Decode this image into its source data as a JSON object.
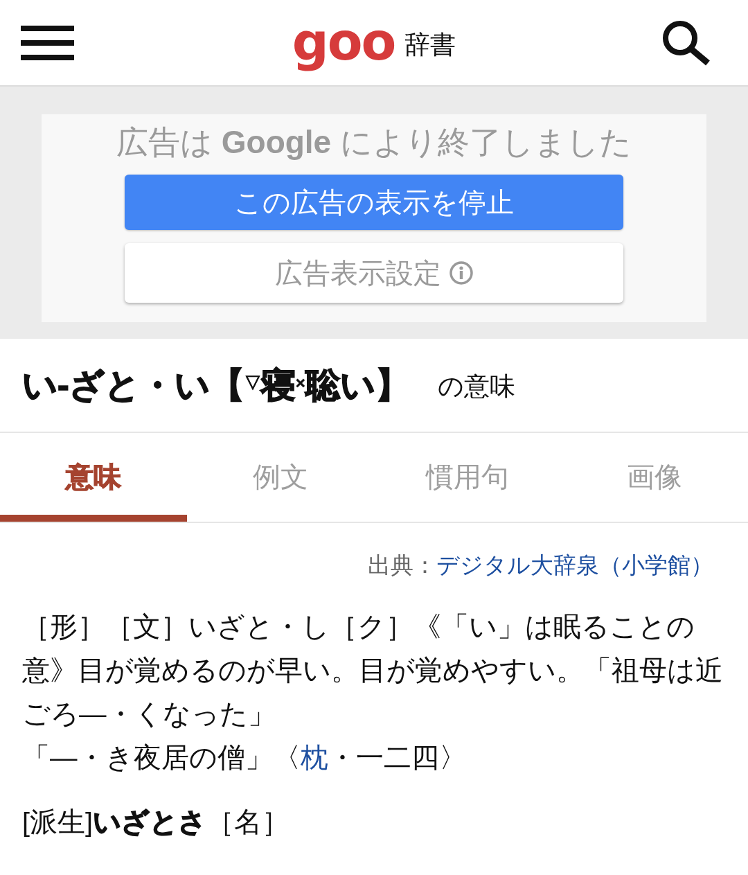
{
  "header": {
    "logo": "goo",
    "logo_label": "辞書"
  },
  "ad_notice": {
    "message": "広告は **Google** により終了しました",
    "buttons": [
      {
        "label": "この広告の表示を停止",
        "kind": "primary"
      },
      {
        "label": "広告表示設定",
        "kind": "secondary"
      }
    ]
  },
  "entry": {
    "headword": "い‐ざと・い【$^{▽}$寝$^{×}$聡い】",
    "suffix": "の意味"
  },
  "tabs": [
    {
      "label": "意味",
      "selected": true
    },
    {
      "label": "例文",
      "selected": false
    },
    {
      "label": "慣用句",
      "selected": false
    },
    {
      "label": "画像",
      "selected": false
    }
  ],
  "source": {
    "label": "出典：",
    "link": "デジタル大辞泉（小学館）"
  },
  "definition": {
    "text": "［形］［文］いざと・し［ク］《「い」は眠ることの意》目が覚めるのが早い。目が覚めやすい。「祖母は近ごろ―・くなった」",
    "example": {
      "text": "「―・き夜居の僧」〈",
      "link": "枕",
      "after": "・一二四〉"
    }
  },
  "derived": "[派生]**いざとさ**［名］"
}
